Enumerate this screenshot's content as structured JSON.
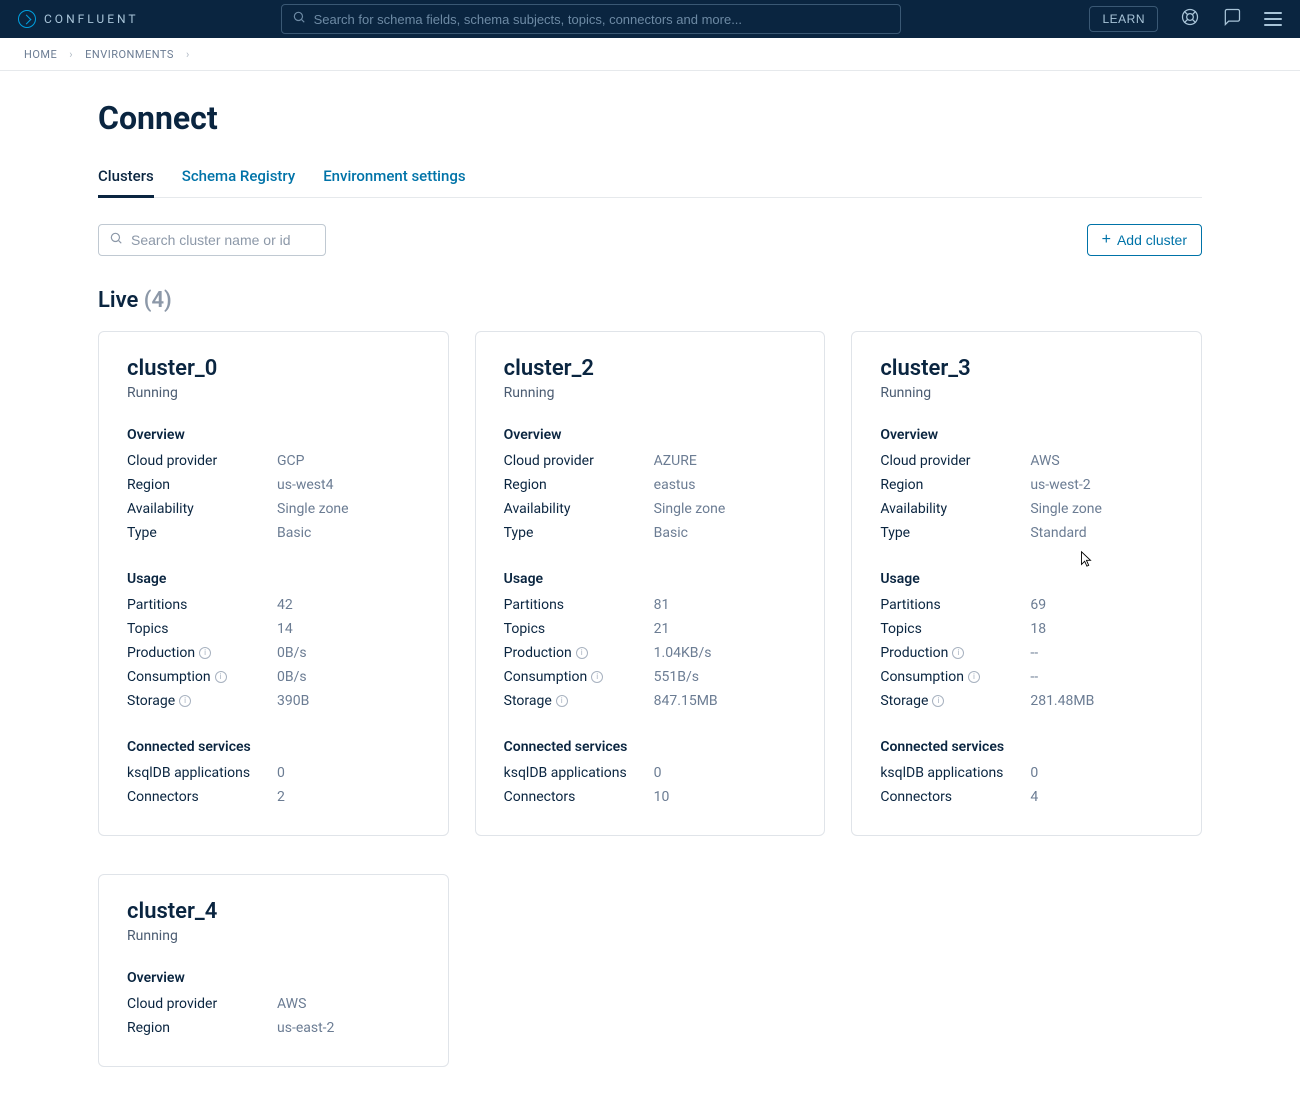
{
  "header": {
    "brand": "CONFLUENT",
    "search_placeholder": "Search for schema fields, schema subjects, topics, connectors and more...",
    "learn_label": "LEARN"
  },
  "breadcrumb": {
    "home": "HOME",
    "env": "ENVIRONMENTS"
  },
  "page": {
    "title": "Connect",
    "tabs": [
      "Clusters",
      "Schema Registry",
      "Environment settings"
    ],
    "cluster_search_placeholder": "Search cluster name or id",
    "add_cluster": "Add cluster",
    "section_label": "Live",
    "section_count": "(4)"
  },
  "labels": {
    "overview": "Overview",
    "usage": "Usage",
    "connected": "Connected services",
    "cloud": "Cloud provider",
    "region": "Region",
    "availability": "Availability",
    "type": "Type",
    "partitions": "Partitions",
    "topics": "Topics",
    "production": "Production",
    "consumption": "Consumption",
    "storage": "Storage",
    "ksql": "ksqlDB applications",
    "connectors": "Connectors"
  },
  "clusters": [
    {
      "name": "cluster_0",
      "status": "Running",
      "cloud": "GCP",
      "region": "us-west4",
      "availability": "Single zone",
      "type": "Basic",
      "partitions": "42",
      "topics": "14",
      "production": "0B/s",
      "consumption": "0B/s",
      "storage": "390B",
      "ksql": "0",
      "connectors": "2"
    },
    {
      "name": "cluster_2",
      "status": "Running",
      "cloud": "AZURE",
      "region": "eastus",
      "availability": "Single zone",
      "type": "Basic",
      "partitions": "81",
      "topics": "21",
      "production": "1.04KB/s",
      "consumption": "551B/s",
      "storage": "847.15MB",
      "ksql": "0",
      "connectors": "10"
    },
    {
      "name": "cluster_3",
      "status": "Running",
      "cloud": "AWS",
      "region": "us-west-2",
      "availability": "Single zone",
      "type": "Standard",
      "partitions": "69",
      "topics": "18",
      "production": "--",
      "consumption": "--",
      "storage": "281.48MB",
      "ksql": "0",
      "connectors": "4"
    },
    {
      "name": "cluster_4",
      "status": "Running",
      "cloud": "AWS",
      "region": "us-east-2",
      "availability": "",
      "type": "",
      "partitions": "",
      "topics": "",
      "production": "",
      "consumption": "",
      "storage": "",
      "ksql": "",
      "connectors": ""
    }
  ]
}
